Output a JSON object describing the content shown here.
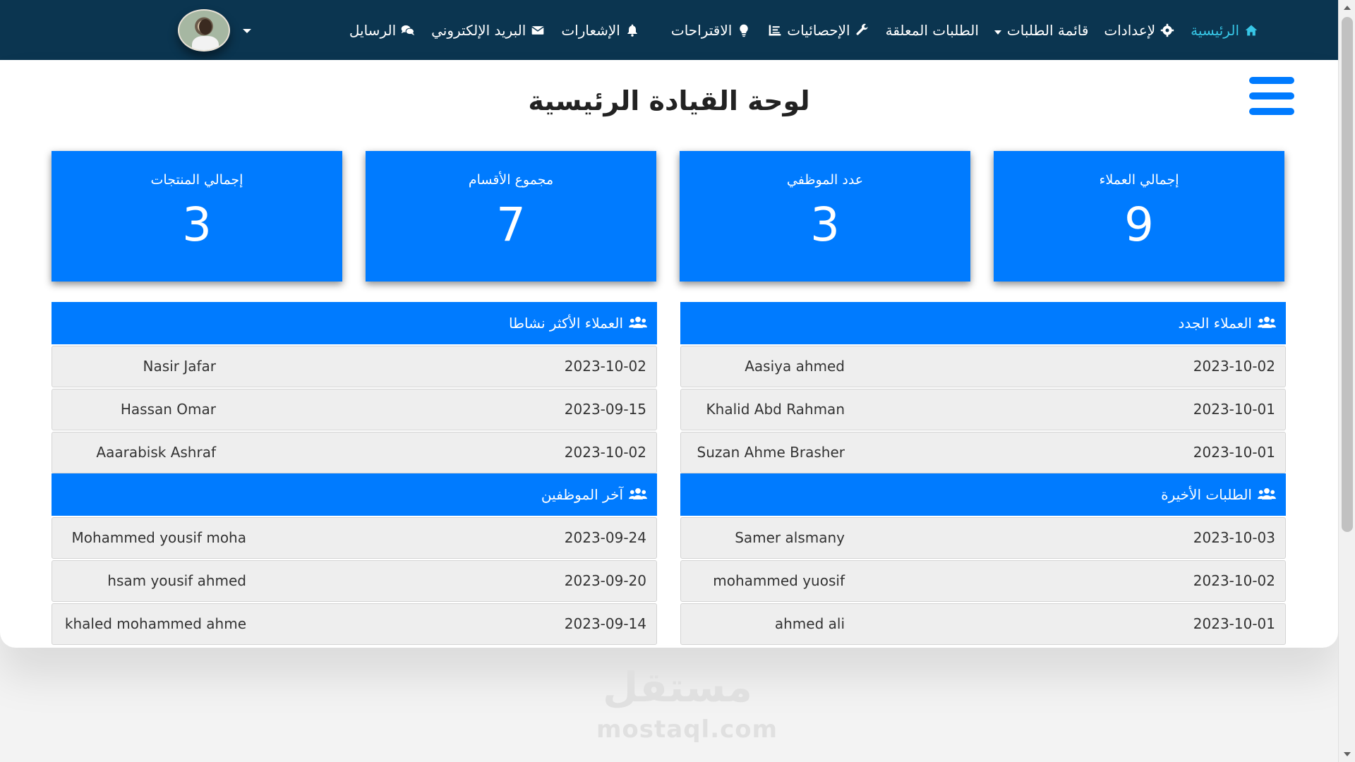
{
  "nav": {
    "home": "الرئيسية",
    "settings": "لإعدادات",
    "orders_list": "قائمة الطلبات",
    "pending_orders": "الطلبات المعلقة",
    "statistics": "الإحصائيات",
    "suggestions": "الاقتراحات",
    "notifications": "الإشعارات",
    "email": "البريد الإلكتروني",
    "messages": "الرسايل"
  },
  "page_title": "لوحة القيادة الرئيسية",
  "stats": [
    {
      "label": "إجمالي العملاء",
      "value": "9"
    },
    {
      "label": "عدد الموظفي",
      "value": "3"
    },
    {
      "label": "مجموع الأقسام",
      "value": "7"
    },
    {
      "label": "إجمالي المنتجات",
      "value": "3"
    }
  ],
  "new_customers": {
    "title": "العملاء الجدد",
    "rows": [
      {
        "date": "2023-10-02",
        "name": "Aasiya ahmed"
      },
      {
        "date": "2023-10-01",
        "name": "Khalid Abd Rahman"
      },
      {
        "date": "2023-10-01",
        "name": "Suzan Ahme Brasher"
      }
    ]
  },
  "active_customers": {
    "title": "العملاء الأكثر نشاطا",
    "rows": [
      {
        "date": "2023-10-02",
        "name": "Nasir Jafar"
      },
      {
        "date": "2023-09-15",
        "name": "Hassan Omar"
      },
      {
        "date": "2023-10-02",
        "name": "Aaarabisk Ashraf"
      }
    ]
  },
  "recent_orders": {
    "title": "الطلبات الأخيرة",
    "rows": [
      {
        "date": "2023-10-03",
        "name": "Samer alsmany"
      },
      {
        "date": "2023-10-02",
        "name": "mohammed yuosif"
      },
      {
        "date": "2023-10-01",
        "name": "ahmed ali"
      }
    ]
  },
  "latest_employees": {
    "title": "آخر الموظفين",
    "rows": [
      {
        "date": "2023-09-24",
        "name": "Mohammed yousif moha"
      },
      {
        "date": "2023-09-20",
        "name": "hsam yousif ahmed"
      },
      {
        "date": "2023-09-14",
        "name": "khaled mohammed ahme"
      }
    ]
  },
  "watermark": {
    "logo": "مستقل",
    "url": "mostaql.com"
  },
  "colors": {
    "navbar": "#0b3550",
    "accent": "#007bff",
    "active_nav": "#37c6e6"
  }
}
